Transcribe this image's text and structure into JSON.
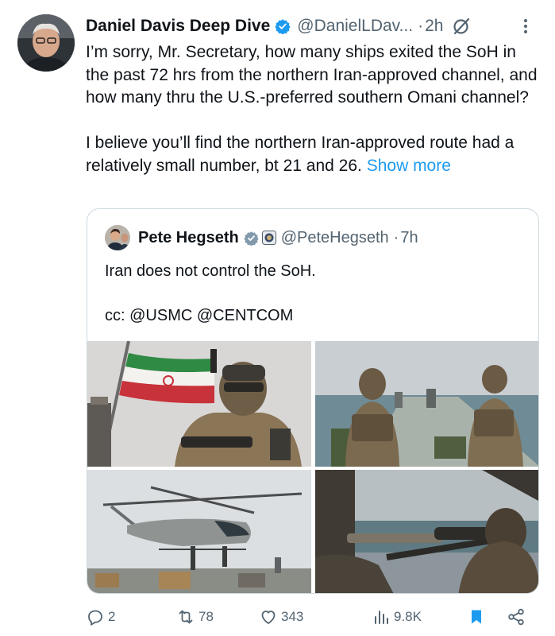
{
  "tweet": {
    "author": {
      "name": "Daniel Davis Deep Dive",
      "handle": "@DanielLDav...",
      "separator": "·",
      "time": "2h"
    },
    "text": {
      "p1": "I’m sorry, Mr. Secretary, how many ships exited the SoH in the past 72 hrs from the northern Iran-approved channel, and how many thru the U.S.-preferred southern Omani channel?",
      "p2": "I believe you’ll find the northern Iran-approved route had a relatively small number, bt 21 and 26.",
      "show_more": "Show more"
    },
    "quote": {
      "author": {
        "name": "Pete Hegseth",
        "handle": "@PeteHegseth",
        "separator": "·",
        "time": "7h"
      },
      "text": {
        "p1": "Iran does not control the SoH.",
        "p2": "cc: @USMC @CENTCOM"
      },
      "media": [
        {
          "subject": "soldier-with-iranian-flag"
        },
        {
          "subject": "soldiers-on-tanker-deck"
        },
        {
          "subject": "helicopter-over-ship"
        },
        {
          "subject": "sniper-on-deck"
        }
      ]
    },
    "actions": {
      "replies": "2",
      "reposts": "78",
      "likes": "343",
      "views": "9.8K"
    },
    "icons": {
      "verified": "verified-badge-icon",
      "grok": "grok-icon",
      "more": "more-options-icon",
      "reply": "reply-icon",
      "repost": "repost-icon",
      "like": "heart-icon",
      "views": "views-icon",
      "bookmark": "bookmark-icon",
      "share": "share-icon"
    },
    "colors": {
      "accent": "#1d9bf0",
      "text": "#0f1419",
      "muted": "#536471",
      "border": "#cfd9de"
    }
  }
}
